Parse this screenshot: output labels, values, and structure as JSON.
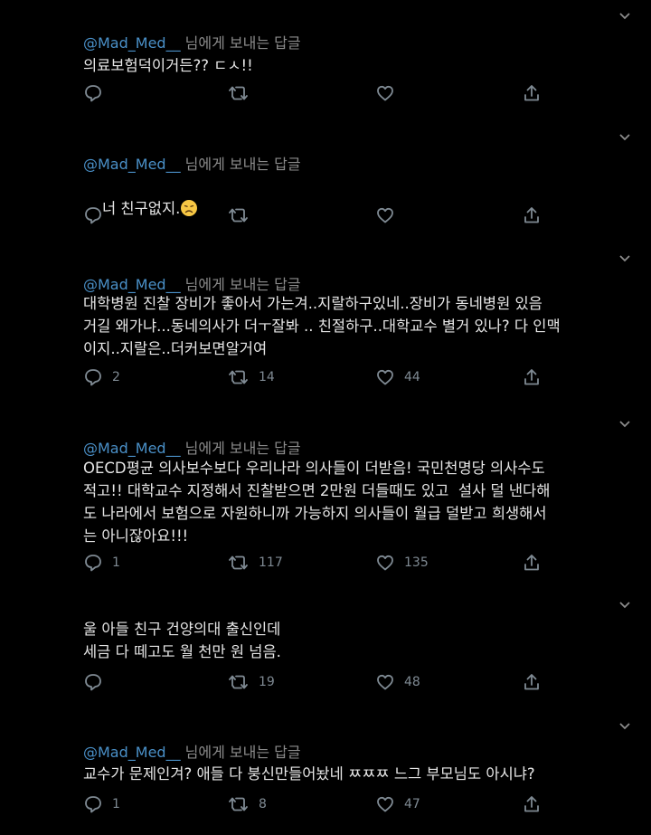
{
  "reply_prefix": "님에게 보내는 답글",
  "tweets": [
    {
      "handle": "@Mad_Med__",
      "text": "의료보험덕이거든?? ㄷㅅ!!",
      "replies": "",
      "retweets": "",
      "likes": ""
    },
    {
      "handle": "@Mad_Med__",
      "text": "너 친구없지.",
      "emoji": "disappointed-face-emoji",
      "replies": "",
      "retweets": "",
      "likes": ""
    },
    {
      "handle": "@Mad_Med__",
      "text": "대학병원 진찰 장비가 좋아서 가는겨..지랄하구있네..장비가 동네병원 있음\n거길 왜가냐...동네의사가 더ㅜ잘봐 .. 친절하구..대학교수 별거 있나? 다 인맥\n이지..지랄은..더커보면알거여",
      "replies": "2",
      "retweets": "14",
      "likes": "44"
    },
    {
      "handle": "@Mad_Med__",
      "text": "OECD평균 의사보수보다 우리나라 의사들이 더받음! 국민천명당 의사수도\n적고!! 대학교수 지정해서 진찰받으면 2만원 더들때도 있고  설사 덜 낸다해\n도 나라에서 보험으로 자원하니까 가능하지 의사들이 월급 덜받고 희생해서\n는 아니잖아요!!!",
      "replies": "1",
      "retweets": "117",
      "likes": "135"
    },
    {
      "handle": "",
      "text": "울 아들 친구 건양의대 출신인데\n세금 다 떼고도 월 천만 원 넘음.",
      "replies": "",
      "retweets": "19",
      "likes": "48"
    },
    {
      "handle": "@Mad_Med__",
      "text": "교수가 문제인겨? 애들 다 붕신만들어놨네 ㅉㅉㅉ 느그 부모님도 아시냐?",
      "replies": "1",
      "retweets": "8",
      "likes": "47"
    }
  ]
}
